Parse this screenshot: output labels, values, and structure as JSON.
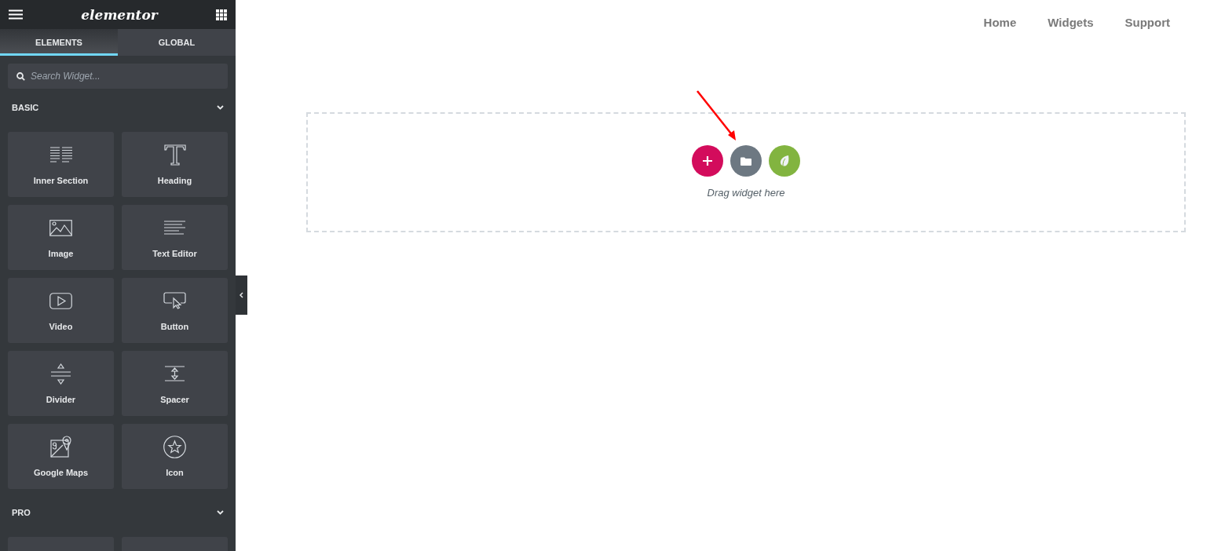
{
  "editor_panel": {
    "header": {
      "logo": "elementor"
    },
    "tabs": [
      {
        "label": "ELEMENTS",
        "selected": true
      },
      {
        "label": "GLOBAL",
        "selected": false
      }
    ],
    "search": {
      "placeholder": "Search Widget..."
    },
    "categories": [
      {
        "title": "BASIC",
        "expanded": true,
        "widgets": [
          {
            "label": "Inner Section",
            "kind": "inner-section"
          },
          {
            "label": "Heading",
            "kind": "heading"
          },
          {
            "label": "Image",
            "kind": "image"
          },
          {
            "label": "Text Editor",
            "kind": "text-editor"
          },
          {
            "label": "Video",
            "kind": "video"
          },
          {
            "label": "Button",
            "kind": "button"
          },
          {
            "label": "Divider",
            "kind": "divider"
          },
          {
            "label": "Spacer",
            "kind": "spacer"
          },
          {
            "label": "Google Maps",
            "kind": "google-maps"
          },
          {
            "label": "Icon",
            "kind": "icon"
          }
        ]
      },
      {
        "title": "PRO",
        "expanded": true,
        "widgets": [
          {
            "kind": "partial"
          },
          {
            "kind": "partial"
          }
        ]
      }
    ]
  },
  "site_nav": [
    "Home",
    "Widgets",
    "Support"
  ],
  "drop_zone": {
    "buttons": [
      {
        "kind": "add",
        "color": "#d30c5c"
      },
      {
        "kind": "template",
        "color": "#6d7882"
      },
      {
        "kind": "elementor",
        "color": "#82b440"
      }
    ],
    "hint": "Drag widget here"
  }
}
